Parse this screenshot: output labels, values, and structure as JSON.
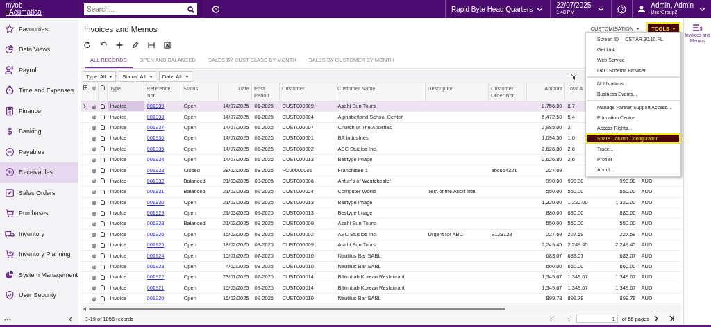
{
  "topbar": {
    "logo": {
      "line1": "myob",
      "line2": "Acumatica"
    },
    "search": {
      "placeholder": "Search..."
    },
    "branch": "Rapid Byte Head Quarters",
    "date": "22/07/2025",
    "time": "1:48 PM",
    "user": {
      "name": "Admin, Admin",
      "group": "UserGroup2"
    }
  },
  "sidebar": {
    "items": [
      {
        "label": "Favourites",
        "selected": false
      },
      {
        "label": "Data Views",
        "selected": false
      },
      {
        "label": "Payroll",
        "selected": false
      },
      {
        "label": "Time and Expenses",
        "selected": false
      },
      {
        "label": "Finance",
        "selected": false
      },
      {
        "label": "Banking",
        "selected": false
      },
      {
        "label": "Payables",
        "selected": false
      },
      {
        "label": "Receivables",
        "selected": true
      },
      {
        "label": "Sales Orders",
        "selected": false
      },
      {
        "label": "Purchases",
        "selected": false
      },
      {
        "label": "Inventory",
        "selected": false
      },
      {
        "label": "Inventory Planning",
        "selected": false
      },
      {
        "label": "System Management",
        "selected": false
      },
      {
        "label": "User Security",
        "selected": false
      }
    ]
  },
  "page": {
    "title": "Invoices and Memos",
    "customisation": "CUSTOMISATION",
    "tools": "TOOLS"
  },
  "tabs": [
    {
      "label": "ALL RECORDS",
      "selected": true
    },
    {
      "label": "OPEN AND BALANCED",
      "selected": false
    },
    {
      "label": "SALES BY CUST CLASS BY MONTH",
      "selected": false
    },
    {
      "label": "SALES BY CUSTOMER BY MONTH",
      "selected": false
    }
  ],
  "filters": [
    "Type: All",
    "Status: All",
    "Date: All"
  ],
  "table": {
    "columns": [
      "Type",
      "Reference Nbr.",
      "Status",
      "Date",
      "Post Period",
      "Customer",
      "Customer Name",
      "Description",
      "Customer Order Nbr.",
      "Amount",
      "Total A"
    ],
    "rows": [
      {
        "selected": true,
        "type": "Invoice",
        "reference_nbr": "001939",
        "status": "Open",
        "date": "14/07/2025",
        "post_period": "01-2026",
        "customer": "CUST000009",
        "customer_name": "Asahi Sun Tours",
        "amount": "8,756.00",
        "total_amount": "8,7"
      },
      {
        "selected": false,
        "type": "Invoice",
        "reference_nbr": "001938",
        "status": "Open",
        "date": "14/07/2025",
        "post_period": "01-2026",
        "customer": "CUST000004",
        "customer_name": "Alphabetland School Center",
        "amount": "5,472.50",
        "total_amount": "5,4"
      },
      {
        "selected": false,
        "type": "Invoice",
        "reference_nbr": "001937",
        "status": "Open",
        "date": "14/07/2025",
        "post_period": "01-2026",
        "customer": "CUST000007",
        "customer_name": "Church of The Apostles",
        "amount": "2,985.00",
        "total_amount": "2,"
      },
      {
        "selected": false,
        "type": "Invoice",
        "reference_nbr": "001936",
        "status": "Open",
        "date": "14/07/2025",
        "post_period": "01-2026",
        "customer": "CUST000001",
        "customer_name": "BA Industries",
        "amount": "1,094.50",
        "total_amount": "1,0"
      },
      {
        "selected": false,
        "type": "Invoice",
        "reference_nbr": "001935",
        "status": "Open",
        "date": "14/07/2025",
        "post_period": "01-2026",
        "customer": "CUST000002",
        "customer_name": "ABC Studios Inc.",
        "amount": "2,626.80",
        "total_amount": "2,6"
      },
      {
        "selected": false,
        "type": "Invoice",
        "reference_nbr": "001934",
        "status": "Open",
        "date": "14/07/2025",
        "post_period": "01-2026",
        "customer": "CUST000013",
        "customer_name": "Bestype Image",
        "amount": "2,626.80",
        "total_amount": "2,6"
      },
      {
        "selected": false,
        "type": "Invoice",
        "reference_nbr": "001933",
        "status": "Closed",
        "date": "28/02/2025",
        "post_period": "08-2025",
        "customer": "FC00000001",
        "customer_name": "Franchisee 1",
        "customer_order_nbr": "abc654321",
        "amount": "227.69"
      },
      {
        "selected": false,
        "type": "Invoice",
        "reference_nbr": "001932",
        "status": "Balanced",
        "date": "21/03/2025",
        "post_period": "09-2025",
        "customer": "CUST000006",
        "customer_name": "Antun's of Westchester",
        "amount": "990.00",
        "total_amount": "990.00",
        "column_12": "990.00",
        "column_13": "AUD"
      },
      {
        "selected": false,
        "type": "Invoice",
        "reference_nbr": "001931",
        "status": "Balanced",
        "date": "21/03/2025",
        "post_period": "09-2025",
        "customer": "CUST000024",
        "customer_name": "Computer World",
        "description": "Test of the Audit Trail",
        "amount": "550.00",
        "total_amount": "550.00",
        "column_12": "550.00",
        "column_13": "AUD"
      },
      {
        "selected": false,
        "type": "Invoice",
        "reference_nbr": "001930",
        "status": "Open",
        "date": "21/03/2025",
        "post_period": "09-2025",
        "customer": "CUST000013",
        "customer_name": "Bestype Image",
        "amount": "1,320.00",
        "total_amount": "1,320.00",
        "column_12": "1,320.00",
        "column_13": "AUD"
      },
      {
        "selected": false,
        "type": "Invoice",
        "reference_nbr": "001929",
        "status": "Open",
        "date": "21/03/2025",
        "post_period": "09-2025",
        "customer": "CUST000013",
        "customer_name": "Bestype Image",
        "amount": "880.00",
        "total_amount": "880.00",
        "column_12": "880.00",
        "column_13": "AUD"
      },
      {
        "selected": false,
        "type": "Invoice",
        "reference_nbr": "001928",
        "status": "Balanced",
        "date": "21/03/2025",
        "post_period": "09-2025",
        "customer": "CUST000009",
        "customer_name": "Asahi Sun Tours",
        "amount": "550.00",
        "total_amount": "550.00",
        "column_12": "550.00",
        "column_13": "AUD"
      },
      {
        "selected": false,
        "type": "Invoice",
        "reference_nbr": "001926",
        "status": "Open",
        "date": "16/03/2025",
        "post_period": "09-2025",
        "customer": "CUST000002",
        "customer_name": "ABC Studios Inc.",
        "description": "Urgent for ABC",
        "customer_order_nbr": "B123123",
        "amount": "227.69",
        "total_amount": "227.69",
        "column_12": "227.69",
        "column_13": "AUD"
      },
      {
        "selected": false,
        "type": "Invoice",
        "reference_nbr": "001925",
        "status": "Open",
        "date": "18/02/2025",
        "post_period": "08-2025",
        "customer": "CUST000009",
        "customer_name": "Asahi Sun Tours",
        "amount": "2,249.45",
        "total_amount": "2,249.45",
        "column_12": "2,249.45",
        "column_13": "AUD"
      },
      {
        "selected": false,
        "type": "Invoice",
        "reference_nbr": "001924",
        "status": "Open",
        "date": "15/01/2025",
        "post_period": "07-2025",
        "customer": "CUST000010",
        "customer_name": "Nautilus Bar SABL",
        "amount": "683.07",
        "total_amount": "683.07",
        "column_12": "683.07",
        "column_13": "AUD"
      },
      {
        "selected": false,
        "type": "Invoice",
        "reference_nbr": "001923",
        "status": "Open",
        "date": "4/02/2025",
        "post_period": "08-2025",
        "customer": "CUST000010",
        "customer_name": "Nautilus Bar SABL",
        "amount": "660.00",
        "total_amount": "660.00",
        "column_12": "660.00",
        "column_13": "AUD"
      },
      {
        "selected": false,
        "type": "Invoice",
        "reference_nbr": "001922",
        "status": "Open",
        "date": "23/01/2025",
        "post_period": "07-2025",
        "customer": "CUST000014",
        "customer_name": "Bibimbab Korean Restaurant",
        "amount": "1,349.67",
        "total_amount": "1,349.67",
        "column_12": "1,349.67",
        "column_13": "AUD"
      },
      {
        "selected": false,
        "type": "Invoice",
        "reference_nbr": "001921",
        "status": "Open",
        "date": "16/03/2025",
        "post_period": "09-2025",
        "customer": "CUST000014",
        "customer_name": "Bibimbab Korean Restaurant",
        "amount": "1,349.67",
        "total_amount": "1,349.67",
        "column_12": "1,349.67",
        "column_13": "AUD"
      },
      {
        "selected": false,
        "type": "Invoice",
        "reference_nbr": "001920",
        "status": "Open",
        "date": "16/03/2025",
        "post_period": "09-2025",
        "customer": "CUST000010",
        "customer_name": "Nautilus Bar SABL",
        "amount": "899.78",
        "total_amount": "899.78",
        "column_12": "899.78",
        "column_13": "AUD"
      }
    ]
  },
  "footer": {
    "records": "1-19 of 1056 records",
    "page": "1",
    "pages": "of 56 pages"
  },
  "tools_menu": {
    "items": [
      {
        "kind": "id",
        "label": "Screen ID",
        "value": "CST.AR.30.10.PL"
      },
      {
        "kind": "item",
        "label": "Get Link",
        "selected": false
      },
      {
        "kind": "item",
        "label": "Web Service",
        "selected": false
      },
      {
        "kind": "item",
        "label": "DAC Schema Browser",
        "selected": false
      },
      {
        "kind": "divider"
      },
      {
        "kind": "item",
        "label": "Notifications...",
        "selected": false
      },
      {
        "kind": "item",
        "label": "Business Events...",
        "selected": false
      },
      {
        "kind": "divider"
      },
      {
        "kind": "item",
        "label": "Manage Partner Support Access...",
        "selected": false
      },
      {
        "kind": "item",
        "label": "Education Centre...",
        "selected": false
      },
      {
        "kind": "item",
        "label": "Access Rights...",
        "selected": false
      },
      {
        "kind": "item",
        "label": "Share Column Configuration",
        "selected": true
      },
      {
        "kind": "item",
        "label": "Trace...",
        "selected": false
      },
      {
        "kind": "item",
        "label": "Profiler",
        "selected": false
      },
      {
        "kind": "item",
        "label": "About...",
        "selected": false
      }
    ]
  },
  "side_panel": {
    "label": "Invoices and Memos"
  }
}
